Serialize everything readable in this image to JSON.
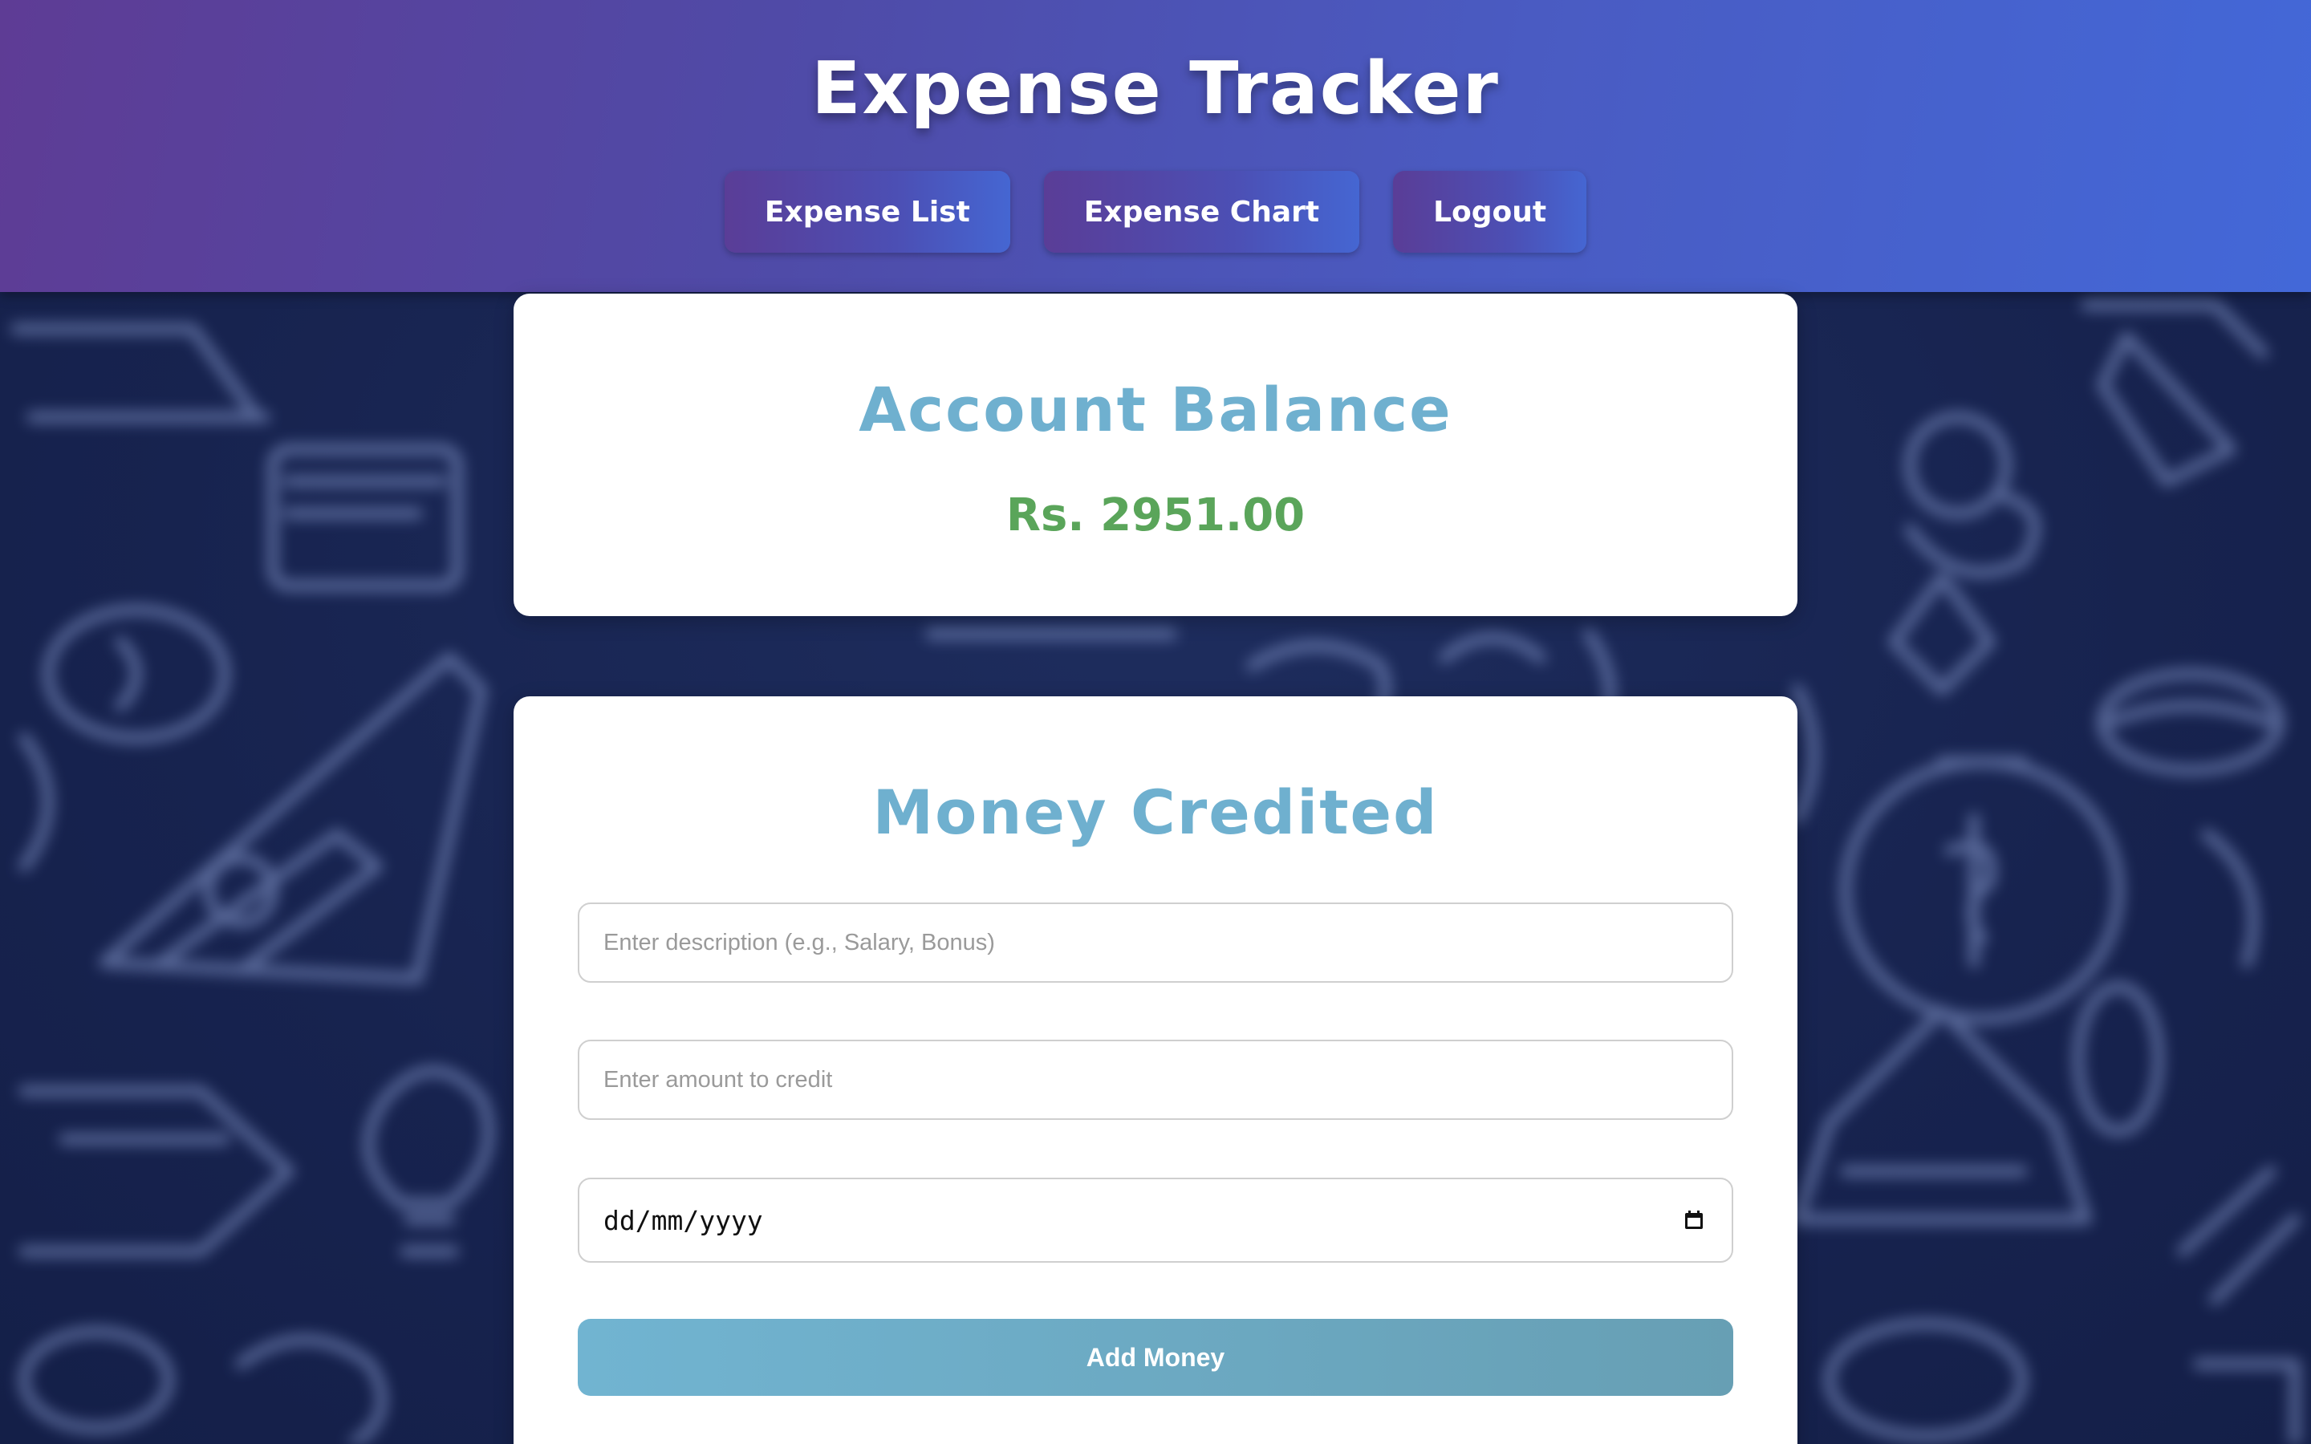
{
  "header": {
    "title": "Expense Tracker",
    "nav": [
      {
        "label": "Expense List"
      },
      {
        "label": "Expense Chart"
      },
      {
        "label": "Logout"
      }
    ]
  },
  "balance": {
    "title": "Account Balance",
    "amount": "Rs. 2951.00"
  },
  "credit_form": {
    "title": "Money Credited",
    "description_placeholder": "Enter description (e.g., Salary, Bonus)",
    "description_value": "",
    "amount_placeholder": "Enter amount to credit",
    "amount_value": "",
    "date_display": "dd/mm/yyyy",
    "submit_label": "Add Money",
    "calendar_icon": "calendar-icon"
  },
  "colors": {
    "header_gradient_start": "#5e3c95",
    "header_gradient_end": "#4368d8",
    "heading_color": "#6fb0cf",
    "balance_color": "#5aa55a",
    "button_color": "#71b4d1",
    "background": "#1a2654"
  }
}
